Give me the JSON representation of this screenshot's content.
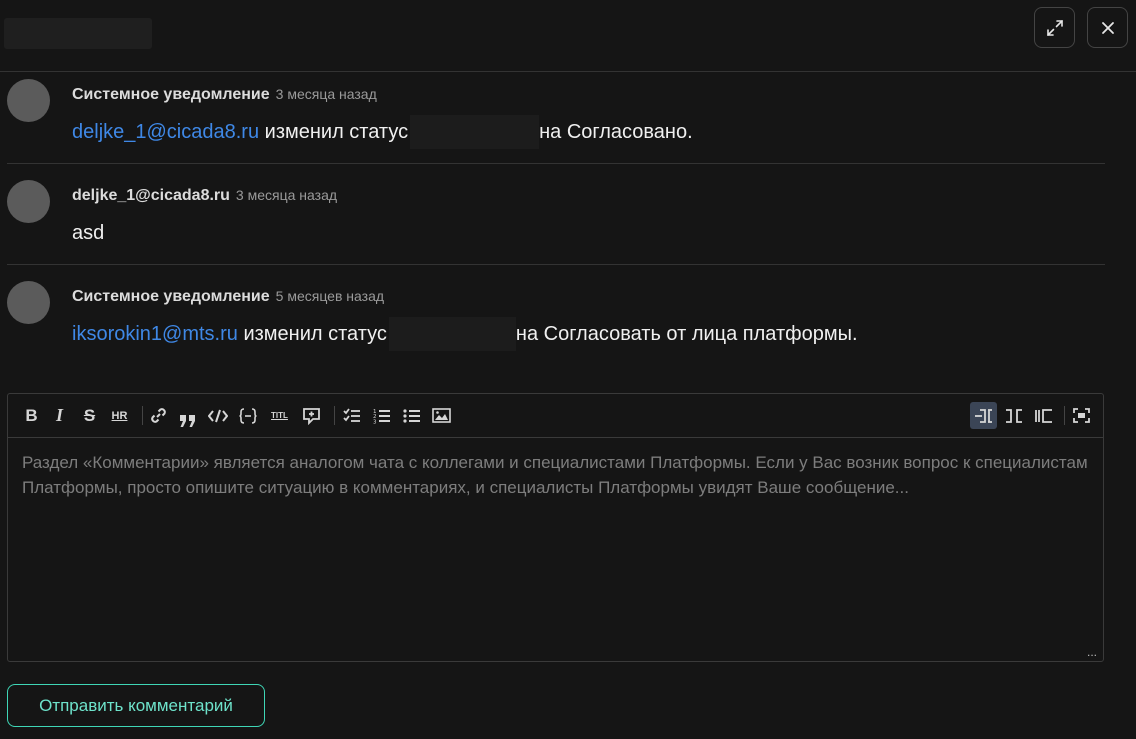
{
  "header": {
    "expand_icon": "expand-icon",
    "close_icon": "close-icon"
  },
  "comments": [
    {
      "author": "Системное уведомление",
      "time": "3 месяца назад",
      "link": "deljke_1@cicada8.ru",
      "text_before": " изменил статус",
      "text_after": "на Согласовано."
    },
    {
      "author": "deljke_1@cicada8.ru",
      "time": "3 месяца назад",
      "text": "asd"
    },
    {
      "author": "Системное уведомление",
      "time": "5 месяцев назад",
      "link": "iksorokin1@mts.ru",
      "text_before": " изменил статус",
      "text_after": "на Согласовать от лица платформы."
    }
  ],
  "editor": {
    "toolbar": {
      "bold": "B",
      "italic": "I",
      "strike": "S",
      "hr": "HR",
      "title": "TITL",
      "tools": [
        "bold",
        "italic",
        "strikethrough",
        "hr",
        "link",
        "quote",
        "code",
        "code-block",
        "title",
        "comment",
        "checklist",
        "ordered-list",
        "unordered-list",
        "image",
        "edit-mode",
        "live-mode",
        "preview-mode",
        "fullscreen"
      ]
    },
    "placeholder": "Раздел «Комментарии» является аналогом чата с коллегами  и специалистами Платформы. Если у Вас возник вопрос к специалистам Платформы, просто опишите ситуацию в комментариях, и специалисты Платформы увидят Ваше сообщение...",
    "resize_handle": "..."
  },
  "send_button": "Отправить комментарий",
  "colors": {
    "background": "#151515",
    "link": "#3f88e6",
    "accent": "#3fd6b6"
  }
}
